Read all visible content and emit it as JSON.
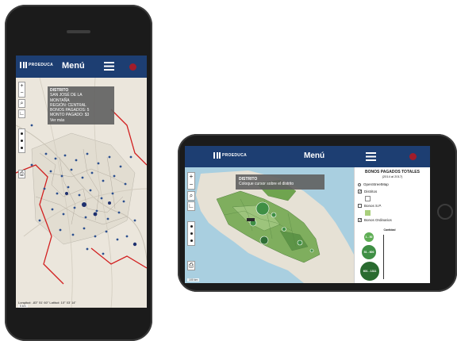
{
  "app": {
    "logo_text": "PROEDUCA",
    "menu_label": "Menú"
  },
  "portrait": {
    "popup": {
      "title": "DISTRITO",
      "lines": [
        "SAN JOSÉ DE LA",
        "MONTAÑA",
        "REGIÓN: CENTRAL",
        "BONOS PAGADOS: 5",
        "MONTO PAGADO: $3",
        "Ver más"
      ]
    },
    "coords": "Longitud: -83° 51' 60\"  Latitud: 10° 03' 14\"",
    "scale": "5 km"
  },
  "landscape": {
    "popup": {
      "title": "DISTRITO",
      "line": "Coloque cursor sobre el distrito"
    },
    "scale": "100 km",
    "panel": {
      "title": "BONOS PAGADOS TOTALES",
      "subtitle": "(2014 al 2017)",
      "base_layer": "OpenStreetMap",
      "layers": [
        "Distritos",
        "Bonos S.P.",
        "Bonos Ordinarios"
      ],
      "bubble_caption": "Cantidad",
      "bubbles": [
        "1 - 50",
        "51 - 600",
        "601 - 1311"
      ]
    }
  },
  "colors": {
    "header": "#1d3e72",
    "alert": "#a11c2a",
    "bubble": "#3f8f45",
    "district_fill": "#7fae5e",
    "border_red": "#d21f1f"
  },
  "icons": {
    "zoom_in": "plus-icon",
    "zoom_out": "minus-icon",
    "search": "search-icon",
    "measure": "ruler-icon",
    "draw": "draw-icon",
    "print": "print-icon"
  }
}
